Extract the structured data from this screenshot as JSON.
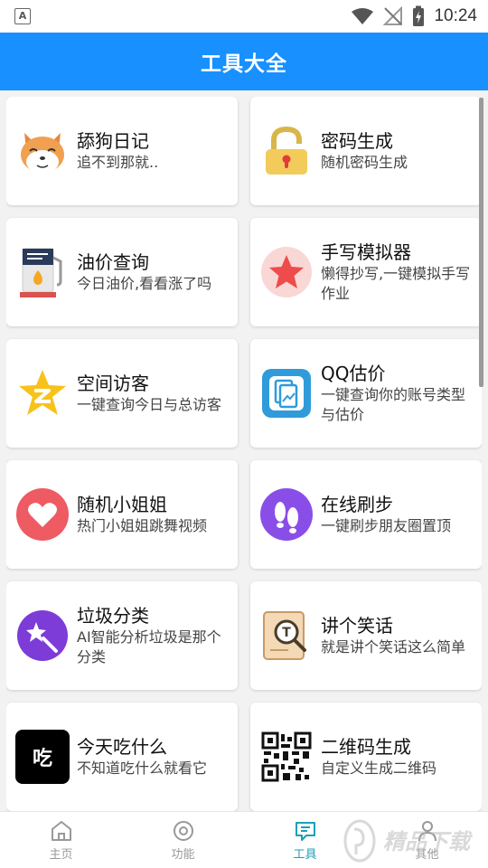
{
  "status_bar": {
    "time": "10:24",
    "app_icon_letter": "A"
  },
  "header": {
    "title": "工具大全"
  },
  "tools": [
    {
      "title": "舔狗日记",
      "desc": "追不到那就..",
      "icon": "dog-icon"
    },
    {
      "title": "密码生成",
      "desc": "随机密码生成",
      "icon": "lock-icon"
    },
    {
      "title": "油价查询",
      "desc": "今日油价,看看涨了吗",
      "icon": "gas-pump-icon"
    },
    {
      "title": "手写模拟器",
      "desc": "懒得抄写,一键模拟手写作业",
      "icon": "star-icon"
    },
    {
      "title": "空间访客",
      "desc": "一键查询今日与总访客",
      "icon": "qzone-star-icon"
    },
    {
      "title": "QQ估价",
      "desc": "一键查询你的账号类型与估价",
      "icon": "document-chart-icon"
    },
    {
      "title": "随机小姐姐",
      "desc": "热门小姐姐跳舞视频",
      "icon": "heart-icon"
    },
    {
      "title": "在线刷步",
      "desc": "一键刷步朋友圈置顶",
      "icon": "footprints-icon"
    },
    {
      "title": "垃圾分类",
      "desc": "AI智能分析垃圾是那个分类",
      "icon": "magic-wand-icon"
    },
    {
      "title": "讲个笑话",
      "desc": "就是讲个笑话这么简单",
      "icon": "magnifier-book-icon"
    },
    {
      "title": "今天吃什么",
      "desc": "不知道吃什么就看它",
      "icon": "eat-icon",
      "glyph": "吃"
    },
    {
      "title": "二维码生成",
      "desc": "自定义生成二维码",
      "icon": "qr-code-icon"
    }
  ],
  "tabs": [
    {
      "label": "主页",
      "icon": "home-icon",
      "active": false
    },
    {
      "label": "功能",
      "icon": "compass-icon",
      "active": false
    },
    {
      "label": "工具",
      "icon": "chat-tool-icon",
      "active": true
    },
    {
      "label": "其他",
      "icon": "person-icon",
      "active": false
    }
  ],
  "watermark": {
    "text": "精品下载"
  },
  "colors": {
    "primary": "#1890ff",
    "active_tab": "#1aa0b8"
  }
}
